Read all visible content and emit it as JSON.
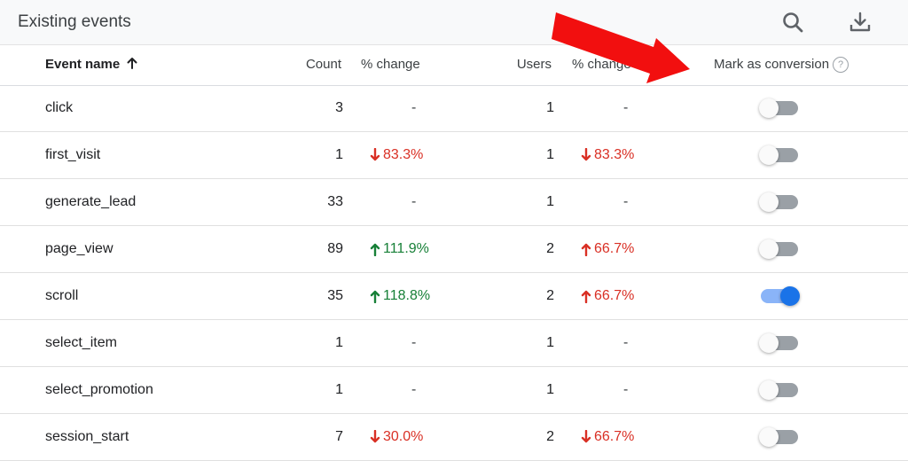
{
  "header": {
    "title": "Existing events",
    "search_icon": "search-icon",
    "download_icon": "download-icon"
  },
  "columns": {
    "event_name": "Event name",
    "sort_icon": "arrow-up-icon",
    "count": "Count",
    "count_change": "% change",
    "users": "Users",
    "users_change": "% change",
    "mark_conversion": "Mark as conversion",
    "help_glyph": "?"
  },
  "colors": {
    "down": "#d93025",
    "up": "#188038",
    "toggle_on": "#1a73e8",
    "annotation_arrow": "#f20f0f"
  },
  "rows": [
    {
      "name": "click",
      "count": "3",
      "count_change": "-",
      "count_dir": "none",
      "users": "1",
      "users_change": "-",
      "users_dir": "none",
      "conversion": false
    },
    {
      "name": "first_visit",
      "count": "1",
      "count_change": "83.3%",
      "count_dir": "down",
      "users": "1",
      "users_change": "83.3%",
      "users_dir": "down",
      "conversion": false
    },
    {
      "name": "generate_lead",
      "count": "33",
      "count_change": "-",
      "count_dir": "none",
      "users": "1",
      "users_change": "-",
      "users_dir": "none",
      "conversion": false
    },
    {
      "name": "page_view",
      "count": "89",
      "count_change": "111.9%",
      "count_dir": "up",
      "users": "2",
      "users_change": "66.7%",
      "users_dir": "up-red",
      "conversion": false
    },
    {
      "name": "scroll",
      "count": "35",
      "count_change": "118.8%",
      "count_dir": "up",
      "users": "2",
      "users_change": "66.7%",
      "users_dir": "up-red",
      "conversion": true
    },
    {
      "name": "select_item",
      "count": "1",
      "count_change": "-",
      "count_dir": "none",
      "users": "1",
      "users_change": "-",
      "users_dir": "none",
      "conversion": false
    },
    {
      "name": "select_promotion",
      "count": "1",
      "count_change": "-",
      "count_dir": "none",
      "users": "1",
      "users_change": "-",
      "users_dir": "none",
      "conversion": false
    },
    {
      "name": "session_start",
      "count": "7",
      "count_change": "30.0%",
      "count_dir": "down",
      "users": "2",
      "users_change": "66.7%",
      "users_dir": "down",
      "conversion": false
    }
  ]
}
